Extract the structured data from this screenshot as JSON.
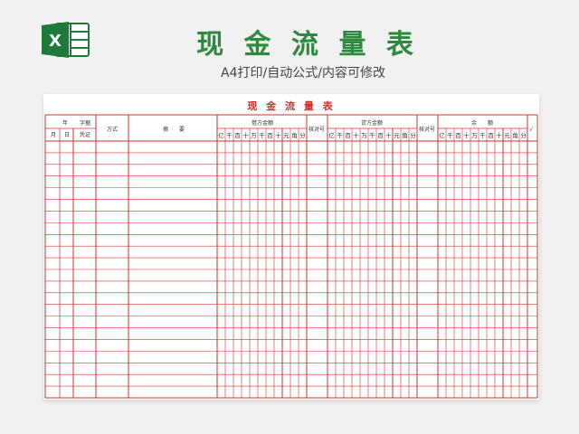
{
  "header": {
    "title": "现 金 流 量 表",
    "subtitle": "A4打印/自动公式/内容可修改",
    "logo_letter": "X",
    "logo_icon": "excel-icon"
  },
  "ledger": {
    "title": "现 金 流 量 表",
    "col_year": "年",
    "col_month": "月",
    "col_day": "日",
    "col_voucher_word": "字据",
    "col_voucher": "凭证",
    "col_method": "方式",
    "col_summary": "摘　　要",
    "debit": "借方金额",
    "check1": "核对号",
    "credit": "贷方金额",
    "check2": "核对号",
    "balance": "余　　额",
    "checkmark": "√",
    "digits": [
      "亿",
      "千",
      "百",
      "十",
      "万",
      "千",
      "百",
      "十",
      "元",
      "角",
      "分"
    ],
    "body_rows": 22,
    "line_color": "#d0302c"
  }
}
